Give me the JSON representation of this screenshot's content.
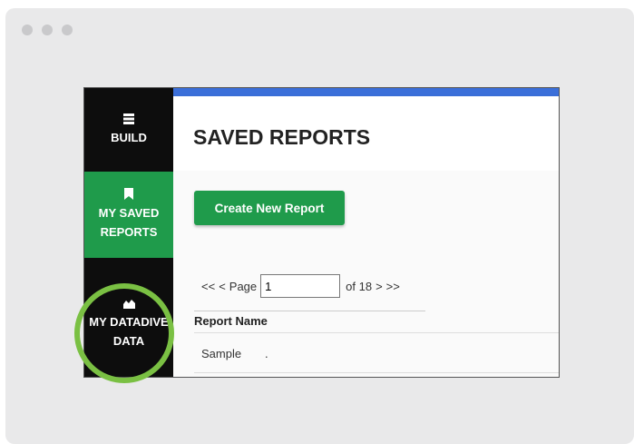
{
  "colors": {
    "window_bg": "#e9e9ea",
    "sidebar_bg": "#0d0d0d",
    "accent_green": "#1f9b4b",
    "top_bar_blue": "#3b6fd9",
    "highlight_ring": "#7ac043"
  },
  "sidebar": {
    "items": [
      {
        "icon": "stack-icon",
        "line1": "BUILD",
        "line2": ""
      },
      {
        "icon": "bookmark-icon",
        "line1": "MY SAVED",
        "line2": "REPORTS"
      },
      {
        "icon": "area-chart-icon",
        "line1": "MY DATADIVE",
        "line2": "DATA"
      }
    ]
  },
  "header": {
    "title": "SAVED REPORTS"
  },
  "toolbar": {
    "create_label": "Create New Report"
  },
  "pager": {
    "first": "<<",
    "prev": "<",
    "page_label": "Page",
    "page_value": "1",
    "of_label": "of 18",
    "next": ">",
    "last": ">>"
  },
  "table": {
    "headers": [
      "Report Name"
    ],
    "rows": [
      [
        "Sample",
        "."
      ]
    ]
  }
}
